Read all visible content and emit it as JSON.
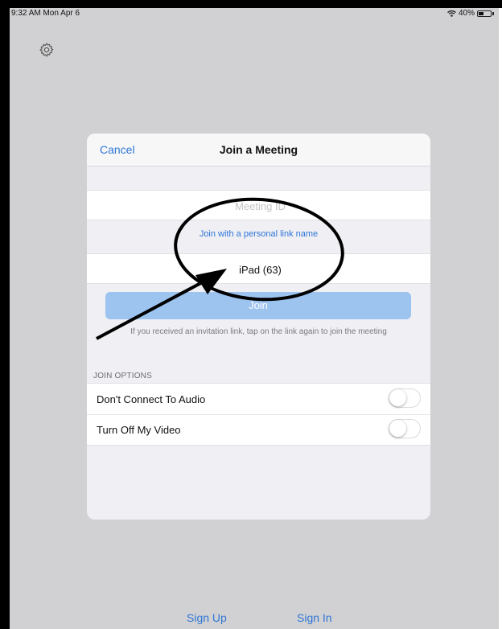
{
  "status_bar": {
    "time": "9:32 AM  Mon Apr 6",
    "battery": "40%",
    "battery_level": 0.4,
    "wifi_icon": "wifi-icon"
  },
  "settings": {
    "icon": "gear-icon"
  },
  "dialog": {
    "cancel_label": "Cancel",
    "title": "Join a Meeting",
    "meeting_id_placeholder": "Meeting ID",
    "personal_link_label": "Join with a personal link name",
    "name_value": "iPad (63)",
    "join_label": "Join",
    "invite_hint": "If you received an invitation link, tap on the link again to join the meeting",
    "join_options_label": "JOIN OPTIONS",
    "options": [
      {
        "label": "Don't Connect To Audio",
        "enabled": false
      },
      {
        "label": "Turn Off My Video",
        "enabled": false
      }
    ]
  },
  "bottom": {
    "sign_up_label": "Sign Up",
    "sign_in_label": "Sign In"
  },
  "colors": {
    "accent": "#2f76d6",
    "join_button": "#9dc3ef",
    "background": "#d1d1d3",
    "annotation": "#000000"
  }
}
